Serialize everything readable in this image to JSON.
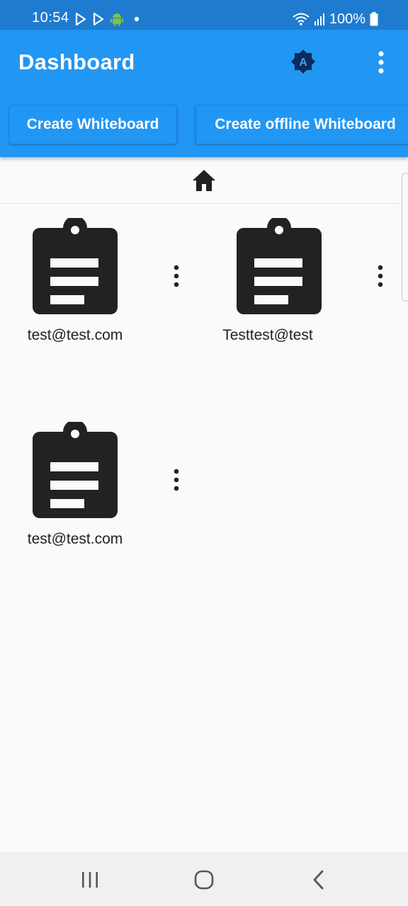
{
  "status_bar": {
    "time": "10:54",
    "battery": "100%",
    "icons_left": [
      "play-store-icon",
      "play-store-icon",
      "android-icon",
      "dot-icon"
    ],
    "icons_right": [
      "wifi-icon",
      "signal-icon",
      "battery-icon"
    ]
  },
  "app_bar": {
    "title": "Dashboard",
    "theme_badge_letter": "A",
    "more_icon": "more-vert-icon"
  },
  "actions": {
    "create_label": "Create Whiteboard",
    "create_offline_label": "Create offline Whiteboard"
  },
  "breadcrumb": {
    "home_icon": "home-icon"
  },
  "whiteboards": [
    {
      "label": "test@test.com",
      "icon": "clipboard-icon"
    },
    {
      "label": "Testtest@test",
      "icon": "clipboard-icon"
    },
    {
      "label": "test@test.com",
      "icon": "clipboard-icon"
    }
  ],
  "nav_bar": {
    "buttons": [
      "recents-icon",
      "home-nav-icon",
      "back-icon"
    ]
  },
  "colors": {
    "status_bar": "#1f7bd0",
    "app_bar": "#2196f3",
    "icon_dark": "#222222",
    "badge": "#0d2b59"
  }
}
